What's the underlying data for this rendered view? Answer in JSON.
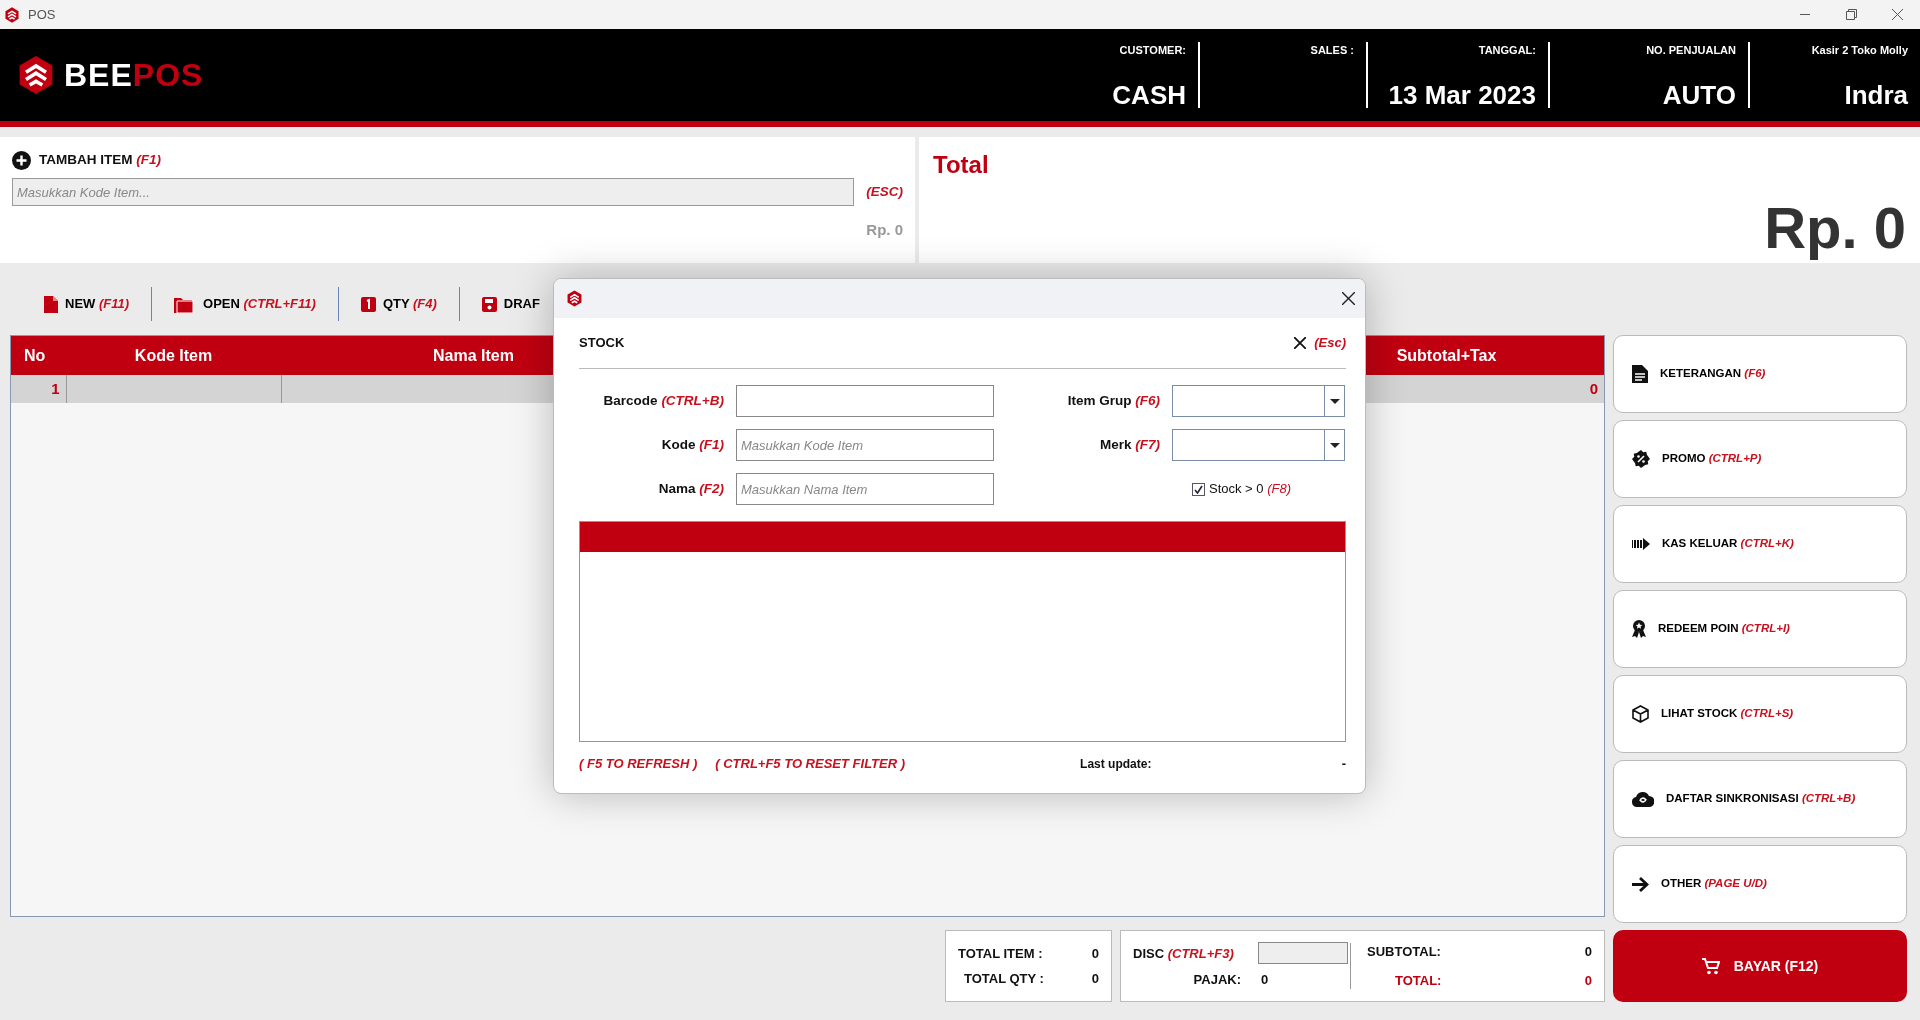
{
  "window": {
    "title": "POS"
  },
  "header": {
    "logo": {
      "part_1": "BEE",
      "part_2": "POS"
    },
    "fields": [
      {
        "label": "CUSTOMER:",
        "value": "CASH"
      },
      {
        "label": "SALES :"
      },
      {
        "label": "TANGGAL:",
        "value": "13 Mar 2023"
      },
      {
        "label": "NO. PENJUALAN",
        "value": "AUTO"
      },
      {
        "label": "Kasir 2 Toko Molly",
        "value": "Indra"
      }
    ]
  },
  "add_item": {
    "title": "TAMBAH ITEM",
    "shortcut": "(F1)",
    "placeholder": "Masukkan Kode Item...",
    "esc": "(ESC)",
    "price": "Rp. 0"
  },
  "total": {
    "title": "Total",
    "amount": "Rp. 0"
  },
  "toolbar": [
    {
      "kind": "new",
      "label": "NEW",
      "shortcut": "(F11)"
    },
    {
      "kind": "open",
      "label": "OPEN",
      "shortcut": "(CTRL+F11)"
    },
    {
      "kind": "qty",
      "label": "QTY",
      "shortcut": "(F4)"
    },
    {
      "kind": "draft",
      "label": "DRAF"
    }
  ],
  "table": {
    "columns": [
      "No",
      "Kode Item",
      "Nama Item",
      "Subtotal+Tax"
    ],
    "rows": [
      {
        "no": "1",
        "subtotal_tax": "0",
        "selected": true
      }
    ]
  },
  "side_buttons": [
    {
      "kind": "notes",
      "label": "KETERANGAN",
      "shortcut": "(F6)"
    },
    {
      "kind": "promo",
      "label": "PROMO",
      "shortcut": "(CTRL+P)"
    },
    {
      "kind": "cash_out",
      "label": "KAS KELUAR",
      "shortcut": "(CTRL+K)"
    },
    {
      "kind": "redeem",
      "label": "REDEEM POIN",
      "shortcut": "(CTRL+I)"
    },
    {
      "kind": "stock",
      "label": "LIHAT STOCK",
      "shortcut": "(CTRL+S)"
    },
    {
      "kind": "sync",
      "label": "DAFTAR SINKRONISASI",
      "shortcut": "(CTRL+B)"
    },
    {
      "kind": "other",
      "label": "OTHER",
      "shortcut": "(PAGE U/D)"
    }
  ],
  "summary": {
    "total_item_label": "TOTAL ITEM :",
    "total_item": "0",
    "total_qty_label": "TOTAL QTY :",
    "total_qty": "0",
    "disc_label": "DISC",
    "disc_shortcut": "(CTRL+F3)",
    "pajak_label": "PAJAK:",
    "pajak": "0",
    "subtotal_label": "SUBTOTAL:",
    "subtotal": "0",
    "total_label": "TOTAL:",
    "total": "0"
  },
  "pay_button": {
    "label": "BAYAR (F12)"
  },
  "dialog": {
    "title": "STOCK",
    "close_shortcut": "(Esc)",
    "fields": [
      {
        "label": "Barcode",
        "shortcut": "(CTRL+B)"
      },
      {
        "label": "Kode",
        "shortcut": "(F1)",
        "placeholder": "Masukkan Kode Item"
      },
      {
        "label": "Nama",
        "shortcut": "(F2)",
        "placeholder": "Masukkan Nama Item"
      }
    ],
    "filters": [
      {
        "label": "Item Grup",
        "shortcut": "(F6)"
      },
      {
        "label": "Merk",
        "shortcut": "(F7)"
      }
    ],
    "stock_filter": {
      "label": "Stock > 0",
      "shortcut": "(F8)",
      "checked": true
    },
    "footer": {
      "refresh": "( F5 TO REFRESH )",
      "reset": "( CTRL+F5 TO RESET FILTER )",
      "last_update_label": "Last update:",
      "last_update": "-"
    }
  }
}
